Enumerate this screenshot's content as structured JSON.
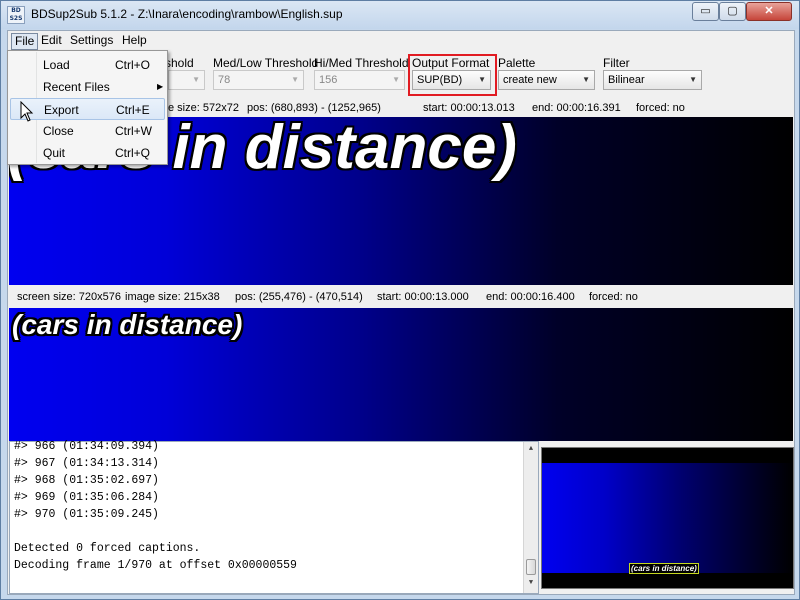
{
  "window": {
    "title": "BDSup2Sub 5.1.2 - Z:\\Inara\\encoding\\rambow\\English.sup",
    "icon_text_top": "BD",
    "icon_text_bottom": "S2S",
    "min_glyph": "▭",
    "max_glyph": "▢",
    "close_glyph": "✕"
  },
  "menubar": {
    "file": "File",
    "edit": "Edit",
    "settings": "Settings",
    "help": "Help"
  },
  "toolbar": {
    "threshold_label_partial": "shold",
    "medlow_label": "Med/Low Threshold",
    "medlow_value": "78",
    "himed_label": "Hi/Med Threshold",
    "himed_value": "156",
    "output_label": "Output Format",
    "output_value": "SUP(BD)",
    "palette_label": "Palette",
    "palette_value": "create new",
    "filter_label": "Filter",
    "filter_value": "Bilinear",
    "highlight_color": "#e11b22"
  },
  "top_info": {
    "image_size_partial": "e size: 572x72",
    "pos": "pos: (680,893) - (1252,965)",
    "start": "start: 00:00:13.013",
    "end": "end: 00:00:16.391",
    "forced": "forced: no"
  },
  "top_preview": {
    "subtitle": "(cars in distance)"
  },
  "bottom_info": {
    "screen_size": "screen size: 720x576",
    "image_size": "image size: 215x38",
    "pos": "pos: (255,476) - (470,514)",
    "start": "start: 00:00:13.000",
    "end": "end: 00:00:16.400",
    "forced": "forced: no"
  },
  "bottom_preview": {
    "subtitle": "(cars in distance)"
  },
  "log": {
    "lines": [
      "#> 966 (01:34:09.394)",
      "#> 967 (01:34:13.314)",
      "#> 968 (01:35:02.697)",
      "#> 969 (01:35:06.284)",
      "#> 970 (01:35:09.245)",
      "",
      "Detected 0 forced captions.",
      "Decoding frame 1/970 at offset 0x00000559"
    ]
  },
  "thumbnail": {
    "subtitle": "(cars in distance)"
  },
  "file_menu": {
    "items": [
      {
        "label": "Load",
        "shortcut": "Ctrl+O"
      },
      {
        "label": "Recent Files",
        "shortcut": ""
      },
      {
        "label": "Export",
        "shortcut": "Ctrl+E"
      },
      {
        "label": "Close",
        "shortcut": "Ctrl+W"
      },
      {
        "label": "Quit",
        "shortcut": "Ctrl+Q"
      }
    ]
  }
}
